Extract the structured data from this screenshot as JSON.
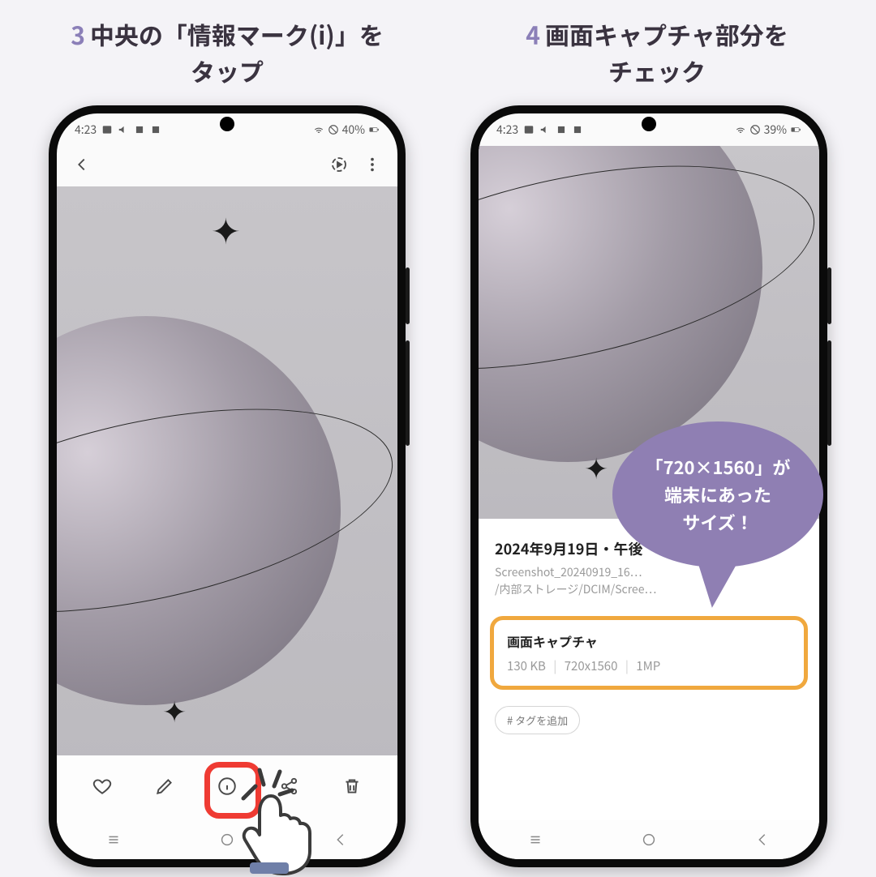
{
  "steps": {
    "s3": {
      "num": "3",
      "text_l1": "中央の「情報マーク(i)」を",
      "text_l2": "タップ"
    },
    "s4": {
      "num": "4",
      "text_l1": "画面キャプチャ部分を",
      "text_l2": "チェック"
    }
  },
  "bubble": {
    "line1": "「720×1560」が",
    "line2": "端末にあった",
    "line3": "サイズ！"
  },
  "status_left": {
    "time": "4:23",
    "battery_label": "40%"
  },
  "status_right": {
    "time": "4:23",
    "battery_label": "39%"
  },
  "info": {
    "date_line": "2024年9月19日・午後",
    "filename": "Screenshot_20240919_16…",
    "path": "/内部ストレージ/DCIM/Scree…",
    "capture_title": "画面キャプチャ",
    "size": "130 KB",
    "dimensions": "720x1560",
    "megapixels": "1MP",
    "tag_label": "# タグを追加"
  },
  "colors": {
    "accent_purple": "#8f7fb3",
    "highlight_red": "#ef3b33",
    "highlight_orange": "#f0a83e"
  }
}
